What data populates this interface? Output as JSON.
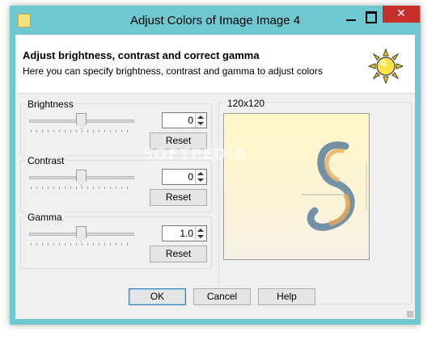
{
  "window": {
    "title": "Adjust Colors of Image Image 4",
    "close_glyph": "✕"
  },
  "header": {
    "title": "Adjust brightness, contrast and correct gamma",
    "subtitle": "Here you can specify brightness, contrast and gamma to adjust colors",
    "icon": "sun-icon"
  },
  "brightness": {
    "label": "Brightness",
    "value": "0",
    "slider_level": 0.5,
    "reset_label": "Reset"
  },
  "contrast": {
    "label": "Contrast",
    "value": "0",
    "slider_level": 0.5,
    "reset_label": "Reset"
  },
  "gamma": {
    "label": "Gamma",
    "value": "1.0",
    "slider_level": 0.5,
    "reset_label": "Reset"
  },
  "preview": {
    "size_label": "120x120",
    "watermark": "SOFTPEDIA"
  },
  "buttons": {
    "ok": "OK",
    "cancel": "Cancel",
    "help": "Help"
  },
  "colors": {
    "titlebar": "#6fc8d0",
    "close": "#c7302a",
    "preview_bg": "#fff8c8"
  }
}
